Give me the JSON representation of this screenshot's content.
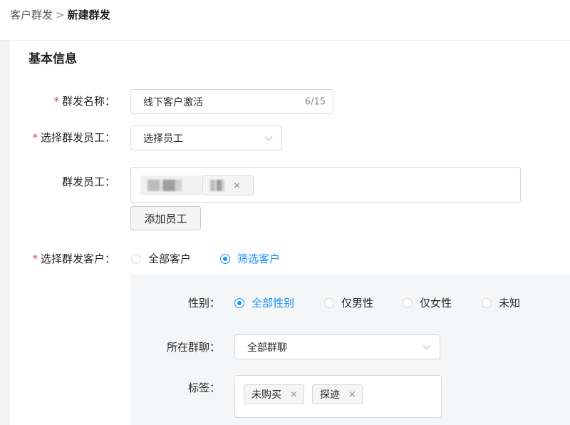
{
  "breadcrumb": {
    "parent": "客户群发",
    "separator": ">",
    "current": "新建群发"
  },
  "section": {
    "title": "基本信息"
  },
  "form": {
    "name": {
      "label": "群发名称：",
      "value": "线下客户激活",
      "count": "6/15"
    },
    "select_staff": {
      "label": "选择群发员工：",
      "value": "选择员工"
    },
    "staff": {
      "label": "群发员工：",
      "add_button": "添加员工",
      "tag_remove": "×"
    },
    "select_customers": {
      "label": "选择群发客户：",
      "options": [
        "全部客户",
        "筛选客户"
      ],
      "selected": "筛选客户"
    },
    "filters": {
      "gender": {
        "label": "性别：",
        "options": [
          "全部性别",
          "仅男性",
          "仅女性",
          "未知"
        ],
        "selected": "全部性别"
      },
      "group_chat": {
        "label": "所在群聊：",
        "value": "全部群聊"
      },
      "tags": {
        "label": "标签：",
        "items": [
          "未购买",
          "探迹"
        ],
        "remove": "×"
      }
    }
  },
  "colors": {
    "accent": "#1890ff",
    "required": "#e5484d"
  },
  "icons": {
    "dropdown": "chevron-down-icon",
    "remove": "close-icon"
  }
}
